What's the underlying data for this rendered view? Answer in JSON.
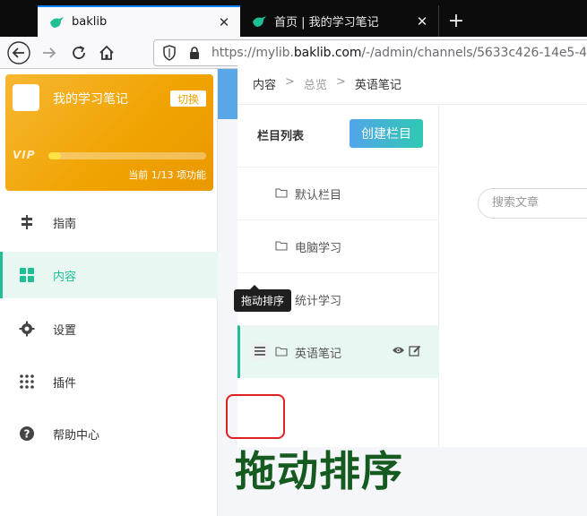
{
  "browser": {
    "tabs": [
      {
        "title": "baklib",
        "close": "✕"
      },
      {
        "title": "首页 | 我的学习笔记",
        "close": "✕"
      }
    ],
    "new_tab": "+",
    "url_prefix": "https://mylib.",
    "url_host": "baklib.com",
    "url_rest": "/-/admin/channels/5633c426-14e5-4"
  },
  "sidebar": {
    "library_name": "我的学习笔记",
    "switch_label": "切换",
    "vip_label": "VIP",
    "vip_progress": 0.077,
    "vip_note": "当前 1/13 项功能",
    "items": [
      {
        "label": "指南",
        "icon": "guide-icon"
      },
      {
        "label": "内容",
        "icon": "grid-icon"
      },
      {
        "label": "设置",
        "icon": "gear-icon"
      },
      {
        "label": "插件",
        "icon": "dots-grid-icon"
      },
      {
        "label": "帮助中心",
        "icon": "help-icon"
      }
    ]
  },
  "breadcrumb": {
    "items": [
      "内容",
      "总览",
      "英语笔记"
    ],
    "separator": ">"
  },
  "columns": {
    "title": "栏目列表",
    "create_label": "创建栏目",
    "items": [
      {
        "label": "默认栏目"
      },
      {
        "label": "电脑学习"
      },
      {
        "label": "统计学习"
      },
      {
        "label": "英语笔记"
      }
    ]
  },
  "tooltip": "拖动排序",
  "annotation": "拖动排序",
  "search": {
    "placeholder": "搜索文章"
  },
  "colors": {
    "accent": "#1fbe94",
    "vip_card": "#f0a300",
    "header_start": "#5aa6e8",
    "header_end": "#46c4d8",
    "annotation_text": "#155a1e",
    "annotation_circle": "#e02020"
  }
}
